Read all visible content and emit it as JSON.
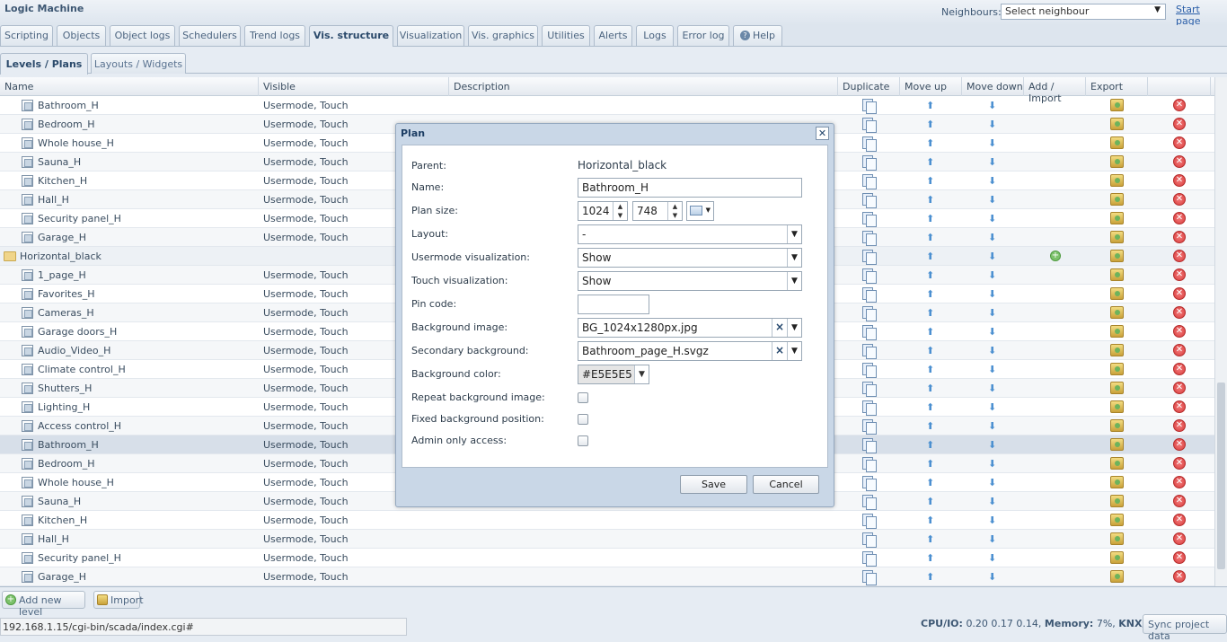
{
  "app": {
    "title": "Logic Machine"
  },
  "neighbours": {
    "label": "Neighbours:",
    "value": "Select neighbour"
  },
  "start_page": "Start page",
  "tabs": [
    "Scripting",
    "Objects",
    "Object logs",
    "Schedulers",
    "Trend logs",
    "Vis. structure",
    "Visualization",
    "Vis. graphics",
    "Utilities",
    "Alerts",
    "Logs",
    "Error log",
    "Help"
  ],
  "subtabs": [
    "Levels / Plans",
    "Layouts / Widgets"
  ],
  "columns": [
    "Name",
    "Visible",
    "Description",
    "Duplicate",
    "Move up",
    "Move down",
    "Add / Import",
    "Export"
  ],
  "rows": [
    {
      "name": "Bathroom_H",
      "visible": "Usermode, Touch"
    },
    {
      "name": "Bedroom_H",
      "visible": "Usermode, Touch"
    },
    {
      "name": "Whole house_H",
      "visible": "Usermode, Touch"
    },
    {
      "name": "Sauna_H",
      "visible": "Usermode, Touch"
    },
    {
      "name": "Kitchen_H",
      "visible": "Usermode, Touch"
    },
    {
      "name": "Hall_H",
      "visible": "Usermode, Touch"
    },
    {
      "name": "Security panel_H",
      "visible": "Usermode, Touch"
    },
    {
      "name": "Garage_H",
      "visible": "Usermode, Touch"
    },
    {
      "name": "Horizontal_black",
      "visible": "",
      "folder": true
    },
    {
      "name": "1_page_H",
      "visible": "Usermode, Touch"
    },
    {
      "name": "Favorites_H",
      "visible": "Usermode, Touch"
    },
    {
      "name": "Cameras_H",
      "visible": "Usermode, Touch"
    },
    {
      "name": "Garage doors_H",
      "visible": "Usermode, Touch"
    },
    {
      "name": "Audio_Video_H",
      "visible": "Usermode, Touch"
    },
    {
      "name": "Climate control_H",
      "visible": "Usermode, Touch"
    },
    {
      "name": "Shutters_H",
      "visible": "Usermode, Touch"
    },
    {
      "name": "Lighting_H",
      "visible": "Usermode, Touch"
    },
    {
      "name": "Access control_H",
      "visible": "Usermode, Touch"
    },
    {
      "name": "Bathroom_H",
      "visible": "Usermode, Touch",
      "selected": true
    },
    {
      "name": "Bedroom_H",
      "visible": "Usermode, Touch"
    },
    {
      "name": "Whole house_H",
      "visible": "Usermode, Touch"
    },
    {
      "name": "Sauna_H",
      "visible": "Usermode, Touch"
    },
    {
      "name": "Kitchen_H",
      "visible": "Usermode, Touch"
    },
    {
      "name": "Hall_H",
      "visible": "Usermode, Touch"
    },
    {
      "name": "Security panel_H",
      "visible": "Usermode, Touch"
    },
    {
      "name": "Garage_H",
      "visible": "Usermode, Touch"
    }
  ],
  "footer": {
    "add_level": "Add new level",
    "import": "Import",
    "url": "192.168.1.15/cgi-bin/scada/index.cgi#",
    "cpu_label": "CPU/IO:",
    "cpu_value": "0.20 0.17 0.14,",
    "mem_label": "Memory:",
    "mem_value": "7%,",
    "knx_label": "KNX/IP",
    "sync": "Sync project data"
  },
  "dialog": {
    "title": "Plan",
    "parent_label": "Parent:",
    "parent_value": "Horizontal_black",
    "name_label": "Name:",
    "name_value": "Bathroom_H",
    "size_label": "Plan size:",
    "width": "1024",
    "height": "748",
    "layout_label": "Layout:",
    "layout_value": "-",
    "usermode_label": "Usermode visualization:",
    "usermode_value": "Show",
    "touch_label": "Touch visualization:",
    "touch_value": "Show",
    "pin_label": "Pin code:",
    "pin_value": "",
    "bg_label": "Background image:",
    "bg_value": "BG_1024x1280px.jpg",
    "bg2_label": "Secondary background:",
    "bg2_value": "Bathroom_page_H.svgz",
    "color_label": "Background color:",
    "color_value": "#E5E5E5",
    "repeat_label": "Repeat background image:",
    "fixed_label": "Fixed background position:",
    "admin_label": "Admin only access:",
    "save": "Save",
    "cancel": "Cancel"
  }
}
